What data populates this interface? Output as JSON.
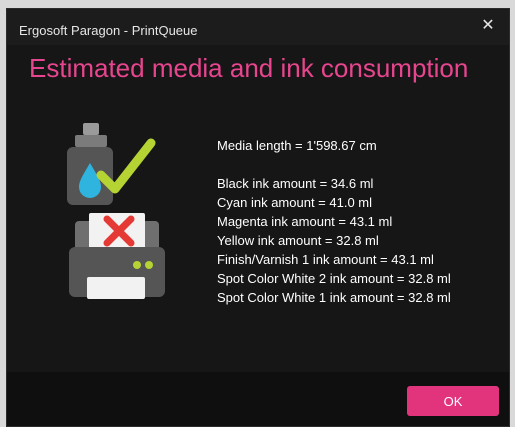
{
  "window": {
    "title": "Ergosoft Paragon - PrintQueue",
    "close_symbol": "✕"
  },
  "main": {
    "heading": "Estimated media and ink consumption",
    "media_length": "Media length = 1'598.67 cm",
    "ink_lines": [
      "Black ink amount = 34.6 ml",
      "Cyan ink amount = 41.0 ml",
      "Magenta ink amount = 43.1 ml",
      "Yellow ink amount = 32.8 ml",
      "Finish/Varnish 1 ink amount = 43.1 ml",
      "Spot Color White 2 ink amount = 32.8 ml",
      "Spot Color White 1 ink amount = 32.8 ml"
    ]
  },
  "footer": {
    "ok_label": "OK"
  },
  "icons": {
    "ink": "ink-bottle-check-icon",
    "printer": "printer-error-icon"
  },
  "colors": {
    "accent": "#e2347d",
    "heading": "#e8458f",
    "check": "#b5d333",
    "error": "#e53935",
    "ink_drop": "#2fb4e0"
  }
}
